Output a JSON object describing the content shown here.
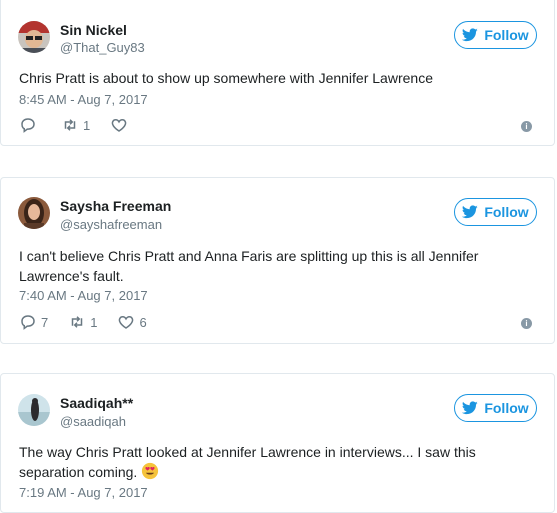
{
  "colors": {
    "accent": "#1b95e0",
    "muted": "#697882",
    "border": "#e1e8ed",
    "heart_emoji": "#f5a623"
  },
  "tweets": [
    {
      "name": "Sin Nickel",
      "handle": "@That_Guy83",
      "follow_label": "Follow",
      "text": "Chris Pratt is about to show up somewhere with Jennifer Lawrence",
      "timestamp": "8:45 AM - Aug 7, 2017",
      "reply_count": "",
      "retweet_count": "1",
      "like_count": "",
      "info_icon": "info-icon"
    },
    {
      "name": "Saysha Freeman",
      "handle": "@sayshafreeman",
      "follow_label": "Follow",
      "text": "I can't believe Chris Pratt and Anna Faris are splitting up this is all Jennifer Lawrence's fault.",
      "timestamp": "7:40 AM - Aug 7, 2017",
      "reply_count": "7",
      "retweet_count": "1",
      "like_count": "6",
      "info_icon": "info-icon"
    },
    {
      "name": "Saadiqah**",
      "handle": "@saadiqah",
      "follow_label": "Follow",
      "text": "The way Chris Pratt looked at Jennifer Lawrence in interviews... I saw this separation coming.",
      "emoji": "heart-eyes-emoji",
      "timestamp": "7:19 AM - Aug 7, 2017"
    }
  ]
}
